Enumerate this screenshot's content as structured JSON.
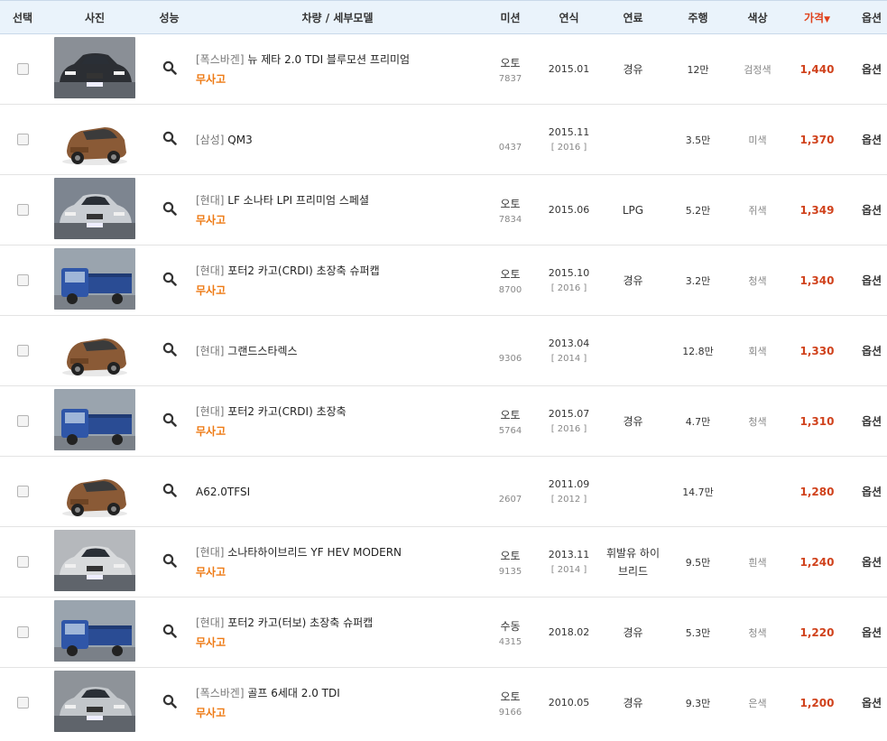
{
  "header": {
    "select": "선택",
    "photo": "사진",
    "performance": "성능",
    "model": "차량 / 세부모델",
    "mission": "미션",
    "year": "연식",
    "fuel": "연료",
    "mileage": "주행",
    "color": "색상",
    "price": "가격",
    "price_sort_icon": "▼",
    "option": "옵션"
  },
  "colors": {
    "price": "#d0421c",
    "accent_orange": "#ee7a14",
    "header_bg": "#eaf3fb"
  },
  "rows": [
    {
      "brand": "[폭스바겐]",
      "model": "뉴 제타 2.0 TDI 블루모션 프리미엄",
      "badge": "무사고",
      "mission": "오토",
      "mission_no": "7837",
      "year": "2015.01",
      "year_sub": "",
      "fuel": "경유",
      "mileage": "12만",
      "color": "검정색",
      "price": "1,440",
      "option": "옵션",
      "photo": "dark-sedan"
    },
    {
      "brand": "[삼성]",
      "model": "QM3",
      "badge": "",
      "mission": "",
      "mission_no": "0437",
      "year": "2015.11",
      "year_sub": "[ 2016 ]",
      "fuel": "",
      "mileage": "3.5만",
      "color": "미색",
      "price": "1,370",
      "option": "옵션",
      "photo": "brown-suv"
    },
    {
      "brand": "[현대]",
      "model": "LF 소나타 LPI 프리미엄 스페셜",
      "badge": "무사고",
      "mission": "오토",
      "mission_no": "7834",
      "year": "2015.06",
      "year_sub": "",
      "fuel": "LPG",
      "mileage": "5.2만",
      "color": "쥐색",
      "price": "1,349",
      "option": "옵션",
      "photo": "grey-sedan"
    },
    {
      "brand": "[현대]",
      "model": "포터2 카고(CRDI) 초장축 슈퍼캡",
      "badge": "무사고",
      "mission": "오토",
      "mission_no": "8700",
      "year": "2015.10",
      "year_sub": "[ 2016 ]",
      "fuel": "경유",
      "mileage": "3.2만",
      "color": "청색",
      "price": "1,340",
      "option": "옵션",
      "photo": "blue-truck"
    },
    {
      "brand": "[현대]",
      "model": "그랜드스타렉스",
      "badge": "",
      "mission": "",
      "mission_no": "9306",
      "year": "2013.04",
      "year_sub": "[ 2014 ]",
      "fuel": "",
      "mileage": "12.8만",
      "color": "회색",
      "price": "1,330",
      "option": "옵션",
      "photo": "brown-suv"
    },
    {
      "brand": "[현대]",
      "model": "포터2 카고(CRDI) 초장축",
      "badge": "무사고",
      "mission": "오토",
      "mission_no": "5764",
      "year": "2015.07",
      "year_sub": "[ 2016 ]",
      "fuel": "경유",
      "mileage": "4.7만",
      "color": "청색",
      "price": "1,310",
      "option": "옵션",
      "photo": "blue-truck"
    },
    {
      "brand": "",
      "model": "A62.0TFSI",
      "badge": "",
      "mission": "",
      "mission_no": "2607",
      "year": "2011.09",
      "year_sub": "[ 2012 ]",
      "fuel": "",
      "mileage": "14.7만",
      "color": "",
      "price": "1,280",
      "option": "옵션",
      "photo": "brown-suv"
    },
    {
      "brand": "[현대]",
      "model": "소나타하이브리드 YF HEV MODERN",
      "badge": "무사고",
      "mission": "오토",
      "mission_no": "9135",
      "year": "2013.11",
      "year_sub": "[ 2014 ]",
      "fuel": "휘발유 하이브리드",
      "mileage": "9.5만",
      "color": "흰색",
      "price": "1,240",
      "option": "옵션",
      "photo": "silver-sedan"
    },
    {
      "brand": "[현대]",
      "model": "포터2 카고(터보) 초장축 슈퍼캡",
      "badge": "무사고",
      "mission": "수동",
      "mission_no": "4315",
      "year": "2018.02",
      "year_sub": "",
      "fuel": "경유",
      "mileage": "5.3만",
      "color": "청색",
      "price": "1,220",
      "option": "옵션",
      "photo": "blue-truck"
    },
    {
      "brand": "[폭스바겐]",
      "model": "골프 6세대 2.0 TDI",
      "badge": "무사고",
      "mission": "오토",
      "mission_no": "9166",
      "year": "2010.05",
      "year_sub": "",
      "fuel": "경유",
      "mileage": "9.3만",
      "color": "은색",
      "price": "1,200",
      "option": "옵션",
      "photo": "silver-hatch"
    }
  ]
}
